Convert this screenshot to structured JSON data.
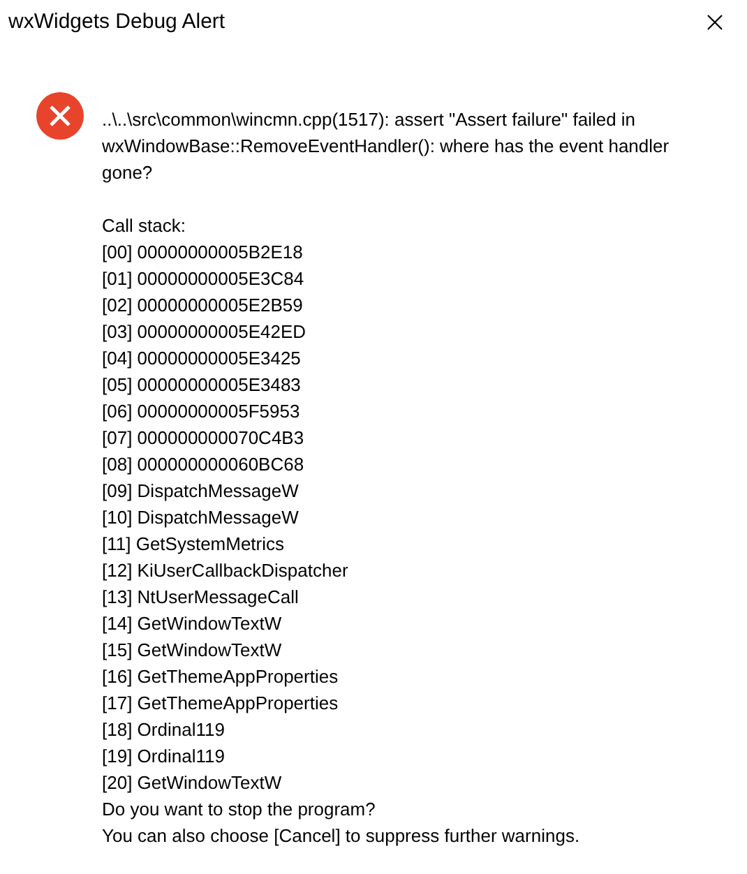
{
  "window": {
    "title": "wxWidgets Debug Alert"
  },
  "message": {
    "kind": "error",
    "text": "..\\..\\src\\common\\wincmn.cpp(1517): assert \"Assert failure\" failed in wxWindowBase::RemoveEventHandler(): where has the event handler gone?",
    "call_stack_label": "Call stack:",
    "call_stack": [
      "[00] 00000000005B2E18",
      "[01] 00000000005E3C84",
      "[02] 00000000005E2B59",
      "[03] 00000000005E42ED",
      "[04] 00000000005E3425",
      "[05] 00000000005E3483",
      "[06] 00000000005F5953",
      "[07] 000000000070C4B3",
      "[08] 000000000060BC68",
      "[09] DispatchMessageW",
      "[10] DispatchMessageW",
      "[11] GetSystemMetrics",
      "[12] KiUserCallbackDispatcher",
      "[13] NtUserMessageCall",
      "[14] GetWindowTextW",
      "[15] GetWindowTextW",
      "[16] GetThemeAppProperties",
      "[17] GetThemeAppProperties",
      "[18] Ordinal119",
      "[19] Ordinal119",
      "[20] GetWindowTextW"
    ],
    "question": "Do you want to stop the program?",
    "hint": "You can also choose [Cancel] to suppress further warnings."
  }
}
